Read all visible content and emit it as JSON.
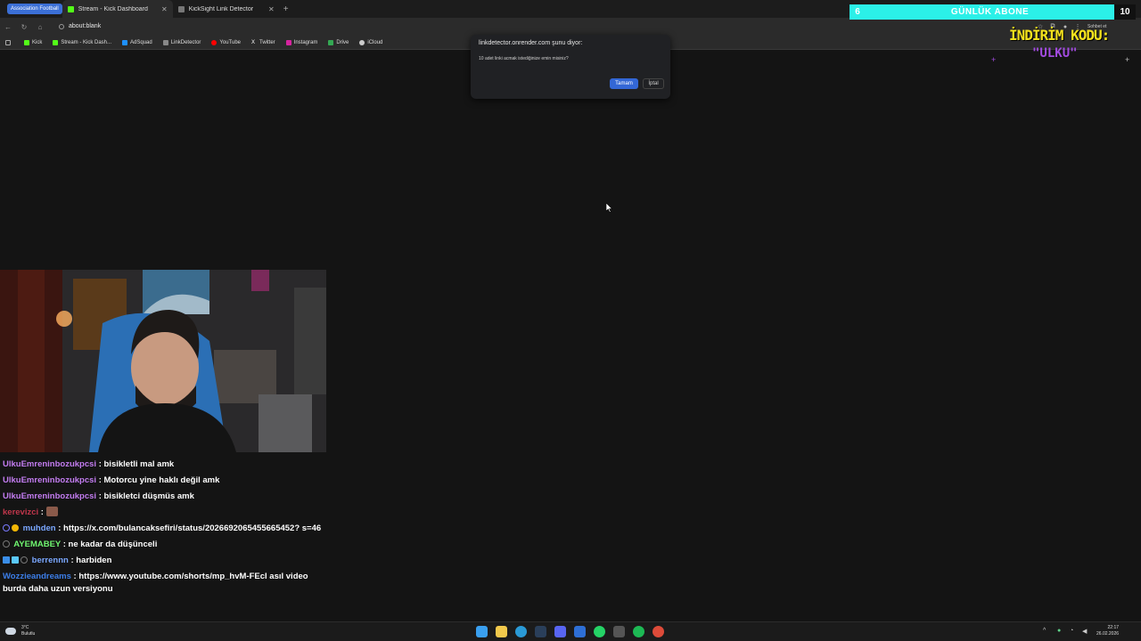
{
  "browser": {
    "tab_group": "Association Football",
    "tabs": [
      {
        "label": "Stream - Kick Dashboard",
        "icon": "kick-icon",
        "color": "#53fc18"
      },
      {
        "label": "KickSight Link Detector",
        "icon": "page-icon",
        "color": "#888888"
      }
    ],
    "url": "about:blank",
    "right_toolbar_labels": [
      "Sohbet et",
      "Ayarlar"
    ],
    "bookmarks": [
      {
        "label": "Kick",
        "icon": "kick-icon",
        "color": "#53fc18"
      },
      {
        "label": "Stream - Kick Dash...",
        "icon": "kick-icon",
        "color": "#53fc18"
      },
      {
        "label": "AdSquad",
        "icon": "adsquad-icon",
        "color": "#1e90ff"
      },
      {
        "label": "LinkDetector",
        "icon": "page-icon",
        "color": "#888888"
      },
      {
        "label": "YouTube",
        "icon": "youtube-icon",
        "color": "#ff0000"
      },
      {
        "label": "Twitter",
        "icon": "x-icon",
        "color": "#ffffff"
      },
      {
        "label": "Instagram",
        "icon": "instagram-icon",
        "color": "#d6249f"
      },
      {
        "label": "Drive",
        "icon": "drive-icon",
        "color": "#34a853"
      },
      {
        "label": "iCloud",
        "icon": "apple-icon",
        "color": "#cccccc"
      }
    ]
  },
  "dialog": {
    "title": "linkdetector.onrender.com şunu diyor:",
    "message": "10 adet linki acmak istediğinize emin misiniz?",
    "ok_label": "Tamam",
    "cancel_label": "İptal"
  },
  "overlay": {
    "sub_goal_current": "6",
    "sub_goal_label": "GÜNLÜK ABONE",
    "sub_goal_target": "10",
    "promo_title": "İNDİRİM KODU:",
    "promo_code": "\"ULKU\""
  },
  "chat": [
    {
      "user": "UlkuEmreninbozukpcsi",
      "color": "#c27cf0",
      "text": ": bisikletli mal amk"
    },
    {
      "user": "UlkuEmreninbozukpcsi",
      "color": "#c27cf0",
      "text": ": Motorcu yine haklı değil amk"
    },
    {
      "user": "UlkuEmreninbozukpcsi",
      "color": "#c27cf0",
      "text": ": bisikletci düşmüs amk"
    },
    {
      "user": "kerevizci",
      "color": "#c0364b",
      "text": ":"
    },
    {
      "user": "muhden",
      "color": "#7aa7ff",
      "text": ": https://x.com/bulancaksefiri/status/2026692065455665452? s=46"
    },
    {
      "user": "AYEMABEY",
      "color": "#6ff56f",
      "text": ": ne kadar da düşünceli"
    },
    {
      "user": "berrennn",
      "color": "#7aa7ff",
      "text": ": harbiden"
    },
    {
      "user": "Wozzieandreams",
      "color": "#3c7ee8",
      "text": ": https://www.youtube.com/shorts/mp_hvM-FEcI asıl video burda daha uzun versiyonu"
    }
  ],
  "taskbar": {
    "weather_temp": "3°C",
    "weather_desc": "Bulutlu",
    "time": "22:17",
    "date": "26.02.2026",
    "apps": [
      {
        "name": "windows-start-icon",
        "color": "#3aa0f0"
      },
      {
        "name": "file-explorer-icon",
        "color": "#f2c94c"
      },
      {
        "name": "edge-icon",
        "color": "#2a9ad6"
      },
      {
        "name": "steam-icon",
        "color": "#1b2838"
      },
      {
        "name": "discord-icon",
        "color": "#5865f2"
      },
      {
        "name": "app-icon",
        "color": "#2e6fd6"
      },
      {
        "name": "whatsapp-icon",
        "color": "#25d366"
      },
      {
        "name": "minimized-app-icon",
        "color": "#888888"
      },
      {
        "name": "spotify-icon",
        "color": "#1db954"
      },
      {
        "name": "chrome-icon",
        "color": "#dd4b39"
      }
    ]
  }
}
